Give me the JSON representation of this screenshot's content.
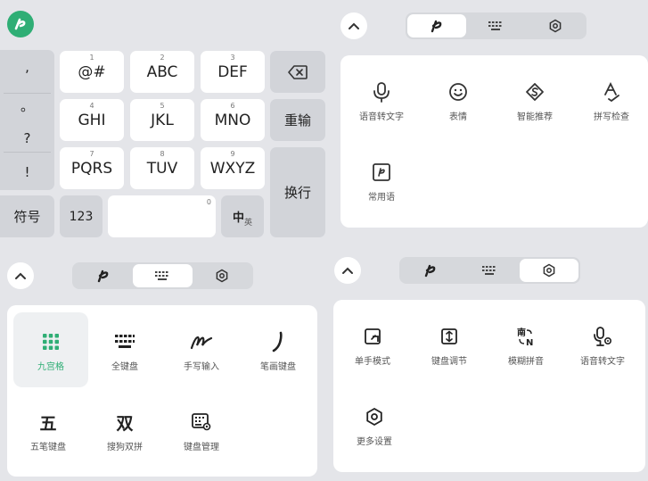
{
  "keyboard": {
    "left_column": [
      ",",
      "。",
      "?",
      "!"
    ],
    "keys": [
      {
        "num": "1",
        "label": "@#"
      },
      {
        "num": "2",
        "label": "ABC"
      },
      {
        "num": "3",
        "label": "DEF"
      },
      {
        "num": "4",
        "label": "GHI"
      },
      {
        "num": "5",
        "label": "JKL"
      },
      {
        "num": "6",
        "label": "MNO"
      },
      {
        "num": "7",
        "label": "PQRS"
      },
      {
        "num": "8",
        "label": "TUV"
      },
      {
        "num": "9",
        "label": "WXYZ"
      }
    ],
    "reinput": "重输",
    "newline": "换行",
    "symbols": "符号",
    "numbers": "123",
    "space_num": "0",
    "lang_main": "中",
    "lang_sub": "英"
  },
  "panel_tr": {
    "items": [
      {
        "label": "语音转文字",
        "icon": "microphone-icon"
      },
      {
        "label": "表情",
        "icon": "emoji-icon"
      },
      {
        "label": "智能推荐",
        "icon": "smart-recommend-icon"
      },
      {
        "label": "拼写检查",
        "icon": "spell-check-icon"
      },
      {
        "label": "常用语",
        "icon": "phrases-icon"
      }
    ]
  },
  "panel_bl": {
    "items": [
      {
        "label": "九宫格",
        "icon": "nine-grid-icon",
        "selected": true
      },
      {
        "label": "全键盘",
        "icon": "full-keyboard-icon"
      },
      {
        "label": "手写输入",
        "icon": "handwriting-icon"
      },
      {
        "label": "笔画键盘",
        "icon": "stroke-keyboard-icon"
      },
      {
        "label": "五笔键盘",
        "icon": "wubi-icon",
        "glyph": "五"
      },
      {
        "label": "搜狗双拼",
        "icon": "shuangpin-icon",
        "glyph": "双"
      },
      {
        "label": "键盘管理",
        "icon": "keyboard-manage-icon"
      }
    ]
  },
  "panel_br": {
    "items": [
      {
        "label": "单手模式",
        "icon": "one-hand-icon"
      },
      {
        "label": "键盘调节",
        "icon": "keyboard-adjust-icon"
      },
      {
        "label": "模糊拼音",
        "icon": "fuzzy-pinyin-icon"
      },
      {
        "label": "语音转文字",
        "icon": "microphone-settings-icon"
      },
      {
        "label": "更多设置",
        "icon": "more-settings-icon"
      }
    ]
  },
  "colors": {
    "accent": "#2fae75",
    "background": "#e4e5e9",
    "key": "#ffffff",
    "function_key": "#d2d4d9"
  }
}
